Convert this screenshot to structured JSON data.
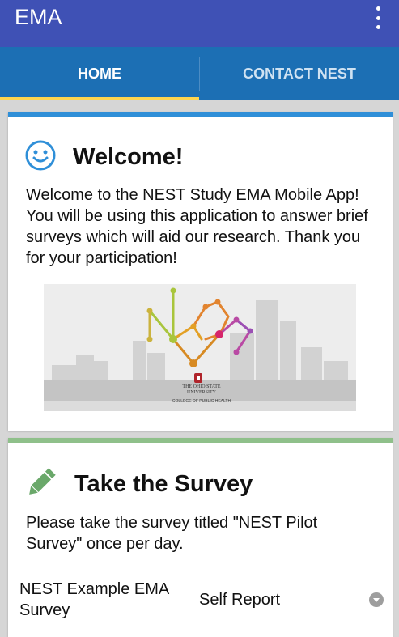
{
  "appbar": {
    "title": "EMA",
    "menu_icon": "more-vert-icon"
  },
  "tabs": [
    {
      "label": "HOME",
      "active": true
    },
    {
      "label": "CONTACT NEST",
      "active": false
    }
  ],
  "welcome": {
    "icon": "smiley-icon",
    "title": "Welcome!",
    "body": "Welcome to the NEST Study EMA Mobile App! You will be using this application to answer brief surveys which will aid our research.  Thank you for your participation!",
    "logo": {
      "institution": "THE OHIO STATE UNIVERSITY",
      "college": "COLLEGE OF PUBLIC HEALTH"
    }
  },
  "survey": {
    "icon": "pencil-icon",
    "title": "Take the Survey",
    "body": "Please take the survey titled \"NEST Pilot Survey\" once per day.",
    "row": {
      "name": "NEST Example EMA Survey",
      "type": "Self Report"
    }
  },
  "colors": {
    "appbar": "#3f51b5",
    "tabbar": "#1c6fb4",
    "tab_indicator": "#ffd54f",
    "card1_accent": "#2f8fd8",
    "card2_accent": "#8fc08a"
  }
}
